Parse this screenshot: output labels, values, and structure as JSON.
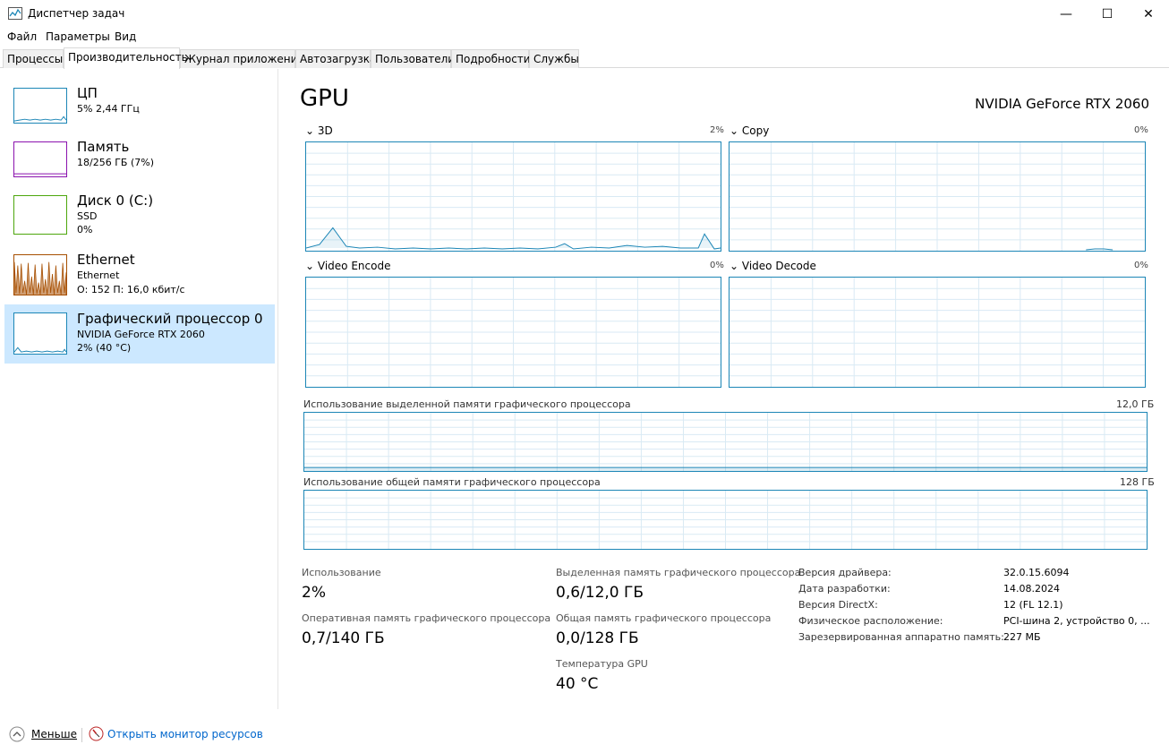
{
  "window": {
    "title": "Диспетчер задач",
    "minimize_glyph": "—",
    "maximize_glyph": "☐",
    "close_glyph": "✕"
  },
  "menu": [
    "Файл",
    "Параметры",
    "Вид"
  ],
  "tabs": [
    "Процессы",
    "Производительность",
    "Журнал приложений",
    "Автозагрузка",
    "Пользователи",
    "Подробности",
    "Службы"
  ],
  "sidebar": {
    "items": [
      {
        "title": "ЦП",
        "sub1": "5% 2,44 ГГц",
        "sub2": ""
      },
      {
        "title": "Память",
        "sub1": "18/256 ГБ (7%)",
        "sub2": ""
      },
      {
        "title": "Диск 0 (C:)",
        "sub1": "SSD",
        "sub2": "0%"
      },
      {
        "title": "Ethernet",
        "sub1": "Ethernet",
        "sub2": "О: 152 П: 16,0 кбит/с"
      },
      {
        "title": "Графический процессор 0",
        "sub1": "NVIDIA GeForce RTX 2060",
        "sub2": "2% (40 °C)"
      }
    ]
  },
  "main": {
    "heading": "GPU",
    "model": "NVIDIA GeForce RTX 2060",
    "engines": [
      {
        "label": "3D",
        "max": "2%"
      },
      {
        "label": "Copy",
        "max": "0%"
      },
      {
        "label": "Video Encode",
        "max": "0%"
      },
      {
        "label": "Video Decode",
        "max": "0%"
      }
    ],
    "dedicated_label": "Использование выделенной памяти графического процессора",
    "dedicated_max": "12,0 ГБ",
    "shared_label": "Использование общей памяти графического процессора",
    "shared_max": "128 ГБ",
    "stats": {
      "usage_label": "Использование",
      "usage_value": "2%",
      "gpu_mem_label": "Оперативная память графического процессора",
      "gpu_mem_value": "0,7/140 ГБ",
      "ded_label": "Выделенная память графического процессора",
      "ded_value": "0,6/12,0 ГБ",
      "shared_label": "Общая память графического процессора",
      "shared_value": "0,0/128 ГБ",
      "temp_label": "Температура GPU",
      "temp_value": "40 °C"
    },
    "info": [
      {
        "k": "Версия драйвера:",
        "v": "32.0.15.6094"
      },
      {
        "k": "Дата разработки:",
        "v": "14.08.2024"
      },
      {
        "k": "Версия DirectX:",
        "v": "12 (FL 12.1)"
      },
      {
        "k": "Физическое расположение:",
        "v": "PCI-шина 2, устройство 0, ..."
      },
      {
        "k": "Зарезервированная аппаратно память:",
        "v": "227 МБ"
      }
    ]
  },
  "footer": {
    "fewer": "Меньше",
    "monitor": "Открыть монитор ресурсов"
  },
  "colors": {
    "gpu": "#1c86b6",
    "cpu": "#1c86b6",
    "memory": "#8b12ae",
    "disk": "#4da60c",
    "ethernet": "#a74f01",
    "selected": "#cce8ff"
  }
}
